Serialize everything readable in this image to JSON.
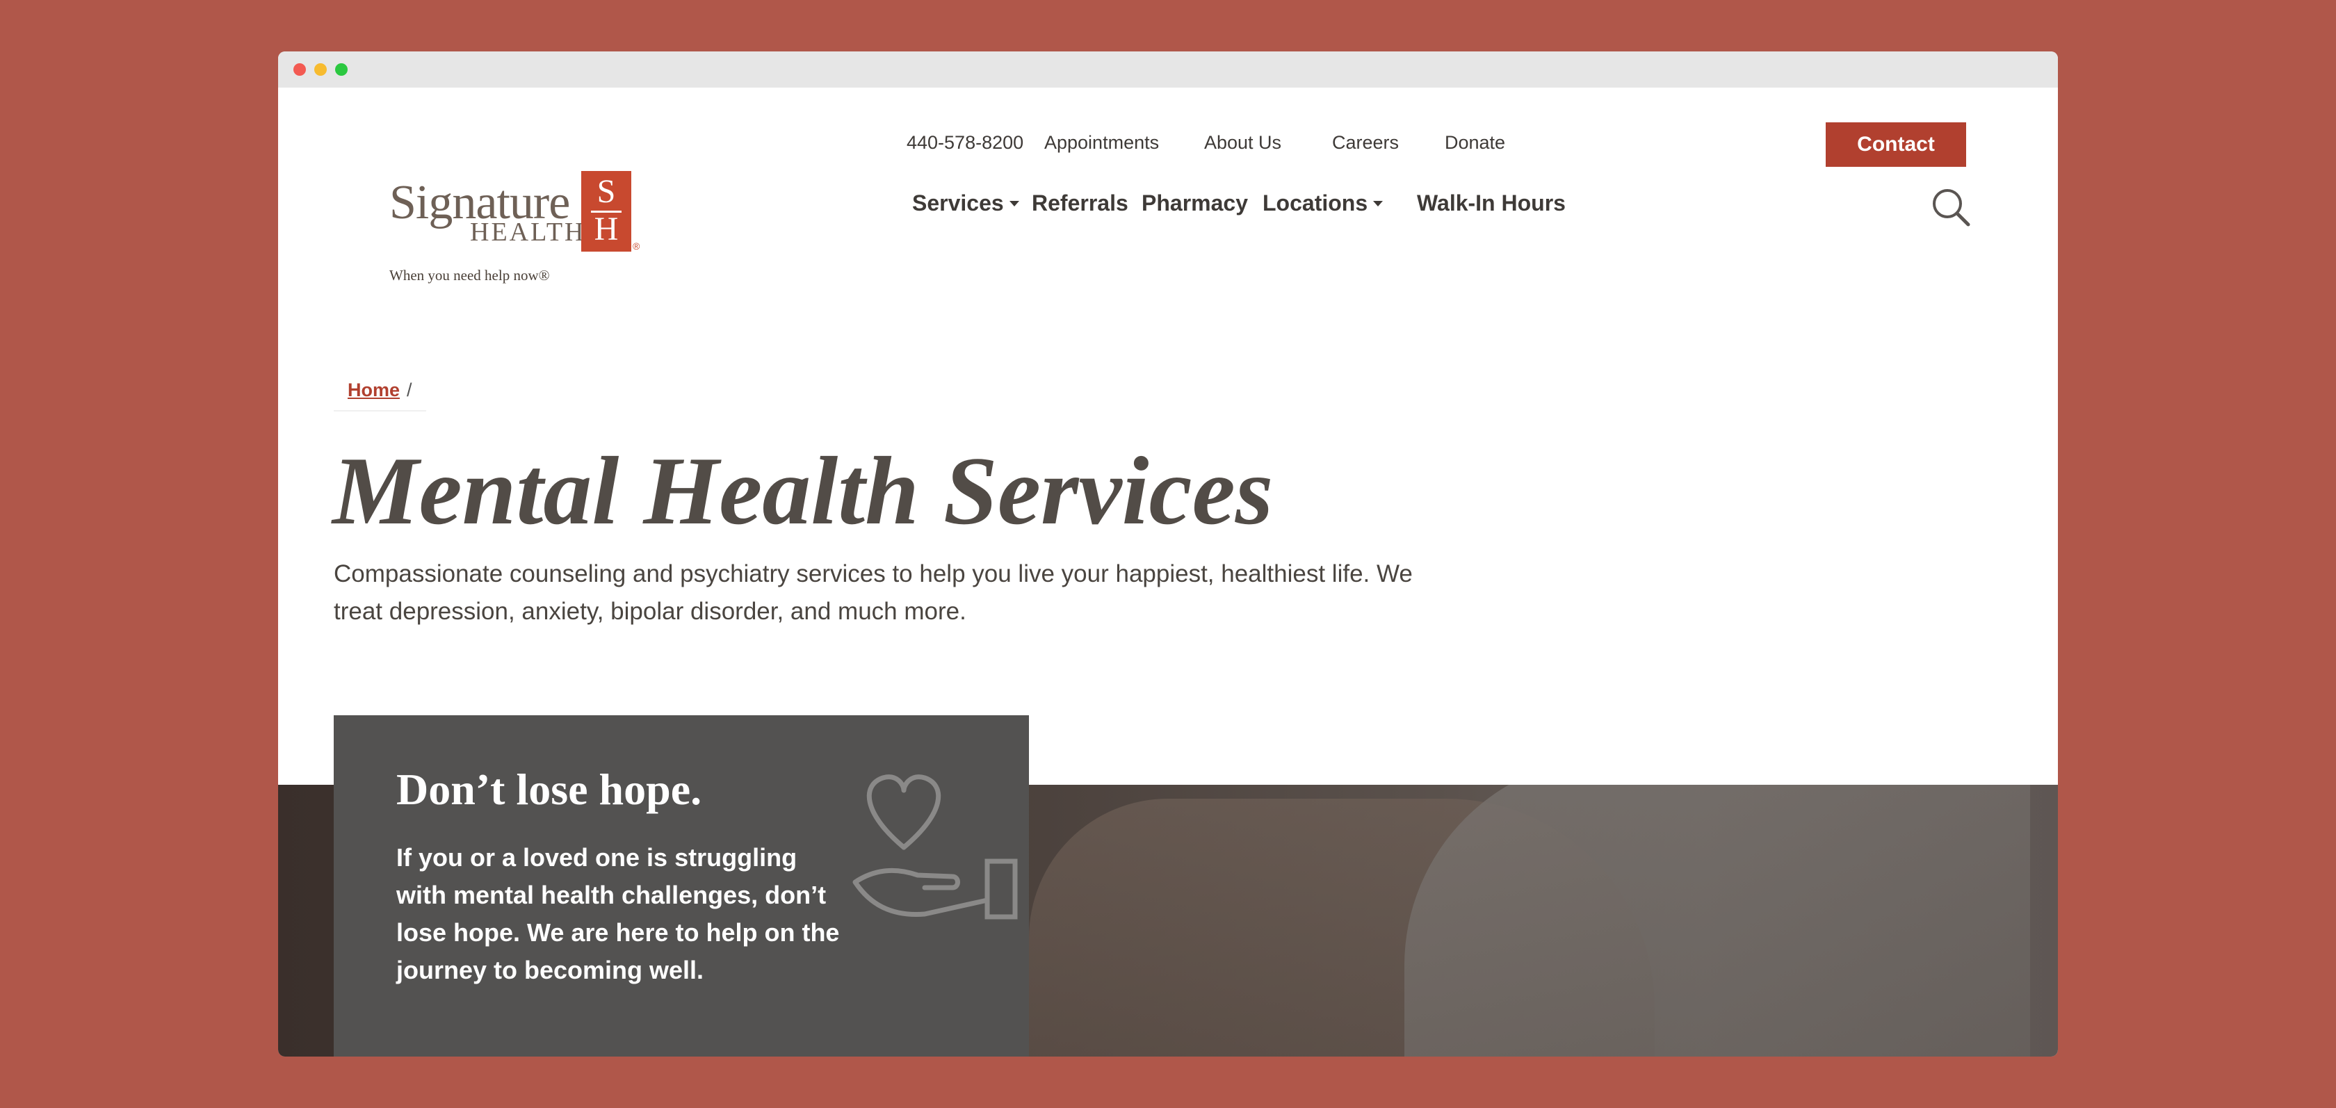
{
  "logo": {
    "wordmark": "Signature",
    "subword": "HEALTH",
    "mark_top": "S",
    "mark_bottom": "H",
    "registered": "®",
    "tagline": "When you need help now®"
  },
  "utility_nav": {
    "phone": "440-578-8200",
    "appointments": "Appointments",
    "about": "About Us",
    "careers": "Careers",
    "donate": "Donate",
    "contact": "Contact"
  },
  "main_nav": {
    "services": "Services",
    "referrals": "Referrals",
    "pharmacy": "Pharmacy",
    "locations": "Locations",
    "walk_in": "Walk-In Hours"
  },
  "breadcrumb": {
    "home": "Home",
    "separator": "/"
  },
  "page": {
    "title": "Mental Health Services",
    "intro": "Compassionate counseling and psychiatry services to help you live your happiest, healthiest life. We treat depression, anxiety, bipolar disorder, and much more."
  },
  "hero": {
    "title": "Don’t lose hope.",
    "text": "If you or a loved one is struggling with mental health challenges, don’t lose hope. We are here to help on the journey to becoming well.",
    "icon": "heart-in-hand-icon"
  },
  "colors": {
    "background": "#b0574a",
    "brand_red": "#c8492f",
    "button_red": "#b1402f",
    "text_dark": "#3e3a37",
    "hero_box": "#535251"
  }
}
